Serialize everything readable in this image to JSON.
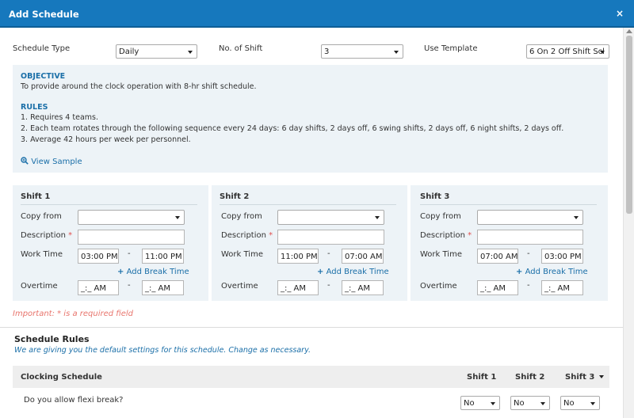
{
  "window": {
    "title": "Add Schedule",
    "close_glyph": "×"
  },
  "top": {
    "schedule_type": {
      "label": "Schedule Type",
      "value": "Daily"
    },
    "no_of_shift": {
      "label": "No. of Shift",
      "value": "3"
    },
    "use_template": {
      "label": "Use Template",
      "value": "6 On 2 Off Shift Scl"
    }
  },
  "info": {
    "objective_heading": "OBJECTIVE",
    "objective_text": "To provide around the clock operation with 8-hr shift schedule.",
    "rules_heading": "RULES",
    "rules": [
      "1. Requires 4 teams.",
      "2. Each team rotates through the following sequence every 24 days: 6 day shifts, 2 days off, 6 swing shifts, 2 days off, 6 night shifts, 2 days off.",
      "3. Average 42 hours per week per personnel."
    ],
    "view_sample": "View Sample"
  },
  "shift_labels": {
    "copy_from": "Copy from",
    "description": "Description",
    "required_mark": "*",
    "work_time": "Work Time",
    "add_break": "Add Break Time",
    "overtime": "Overtime",
    "dash": "-"
  },
  "shifts": [
    {
      "title": "Shift 1",
      "copy_from": "",
      "description": "",
      "work_start": "03:00 PM",
      "work_end": "11:00 PM",
      "ot_start": "_:_ AM",
      "ot_end": "_:_ AM"
    },
    {
      "title": "Shift 2",
      "copy_from": "",
      "description": "",
      "work_start": "11:00 PM",
      "work_end": "07:00 AM",
      "ot_start": "_:_ AM",
      "ot_end": "_:_ AM"
    },
    {
      "title": "Shift 3",
      "copy_from": "",
      "description": "",
      "work_start": "07:00 AM",
      "work_end": "03:00 PM",
      "ot_start": "_:_ AM",
      "ot_end": "_:_ AM"
    }
  ],
  "important": "Important: * is a required field",
  "schedule_rules": {
    "title": "Schedule Rules",
    "subtitle": "We are giving you the default settings for this schedule. Change as necessary.",
    "columns": [
      "Clocking Schedule",
      "Shift 1",
      "Shift 2",
      "Shift 3"
    ],
    "rows": [
      {
        "question": "Do you allow flexi break?",
        "values": [
          "No",
          "No",
          "No"
        ]
      }
    ]
  },
  "colors": {
    "header": "#1678bd",
    "panel": "#edf3f7",
    "link": "#1b6fa8",
    "required": "#e05050"
  },
  "icons": {
    "view_sample": "magnifier-plus-icon",
    "add_break": "plus-icon"
  }
}
